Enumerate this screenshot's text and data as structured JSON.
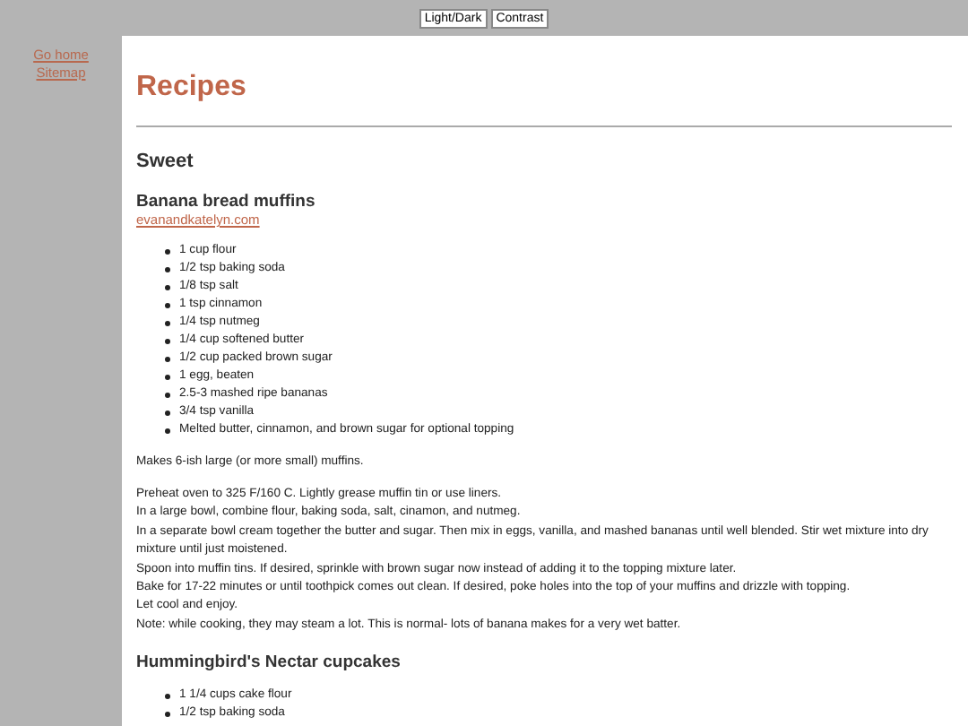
{
  "toolbar": {
    "buttons": [
      "Light/Dark",
      "Contrast"
    ]
  },
  "sidebar": {
    "links": [
      "Go home",
      "Sitemap"
    ]
  },
  "page_title": "Recipes",
  "section": "Sweet",
  "recipes": [
    {
      "title": "Banana bread muffins",
      "source": "evanandkatelyn.com",
      "ingredients": [
        "1 cup flour",
        "1/2 tsp baking soda",
        "1/8 tsp salt",
        "1 tsp cinnamon",
        "1/4 tsp nutmeg",
        "1/4 cup softened butter",
        "1/2 cup packed brown sugar",
        "1 egg, beaten",
        "2.5-3 mashed ripe bananas",
        "3/4 tsp vanilla",
        "Melted butter, cinnamon, and brown sugar for optional topping"
      ],
      "yield": "Makes 6-ish large (or more small) muffins.",
      "steps": [
        "Preheat oven to 325 F/160 C. Lightly grease muffin tin or use liners.",
        "In a large bowl, combine flour, baking soda, salt, cinamon, and nutmeg.",
        "In a separate bowl cream together the butter and sugar. Then mix in eggs, vanilla, and mashed bananas until well blended. Stir wet mixture into dry mixture until just moistened.",
        "Spoon into muffin tins. If desired, sprinkle with brown sugar now instead of adding it to the topping mixture later.",
        "Bake for 17-22 minutes or until toothpick comes out clean. If desired, poke holes into the top of your muffins and drizzle with topping.",
        "Let cool and enjoy.",
        "Note: while cooking, they may steam a lot. This is normal- lots of banana makes for a very wet batter."
      ]
    },
    {
      "title": "Hummingbird's Nectar cupcakes",
      "ingredients": [
        "1 1/4 cups cake flour",
        "1/2 tsp baking soda"
      ]
    }
  ]
}
